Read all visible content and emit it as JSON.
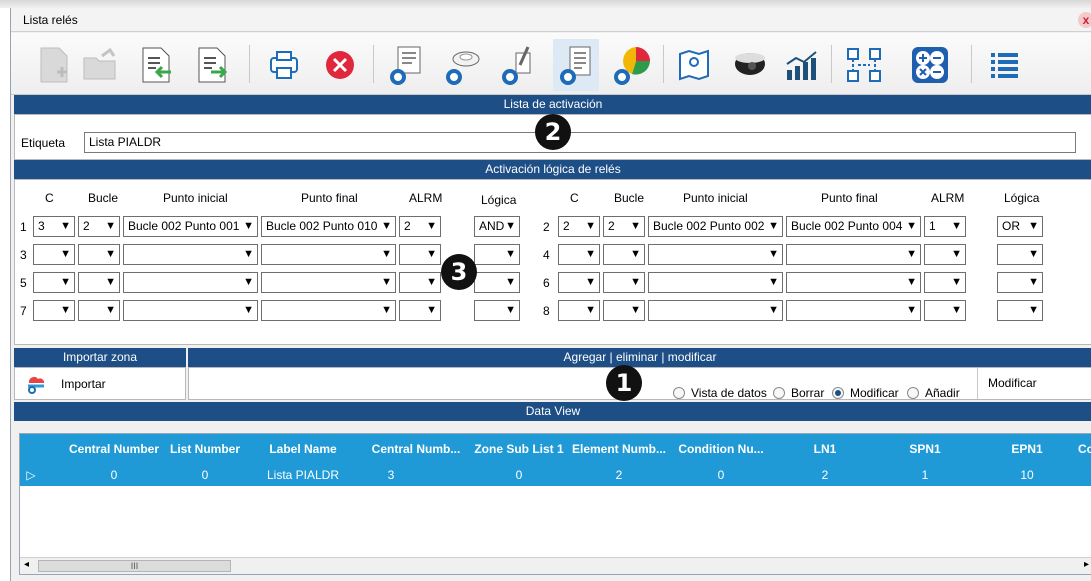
{
  "window": {
    "title": "Lista relés",
    "close_glyph": "x"
  },
  "sections": {
    "activation_list": "Lista de activación",
    "logic": "Activación lógica de relés",
    "import_zone": "Importar zona",
    "edit": "Agregar | eliminar | modificar",
    "data_view": "Data View"
  },
  "etiqueta": {
    "label": "Etiqueta",
    "value": "Lista PIALDR"
  },
  "columns": {
    "c": "C",
    "bucle": "Bucle",
    "punto_inicial": "Punto inicial",
    "punto_final": "Punto final",
    "alrm": "ALRM",
    "logica": "Lógica"
  },
  "rows": [
    {
      "n": "1",
      "c": "3",
      "bucle": "2",
      "inicial": "Bucle 002 Punto 001",
      "final": "Bucle 002 Punto 010",
      "alrm": "2",
      "logica": "AND"
    },
    {
      "n": "2",
      "c": "2",
      "bucle": "2",
      "inicial": "Bucle 002 Punto 002",
      "final": "Bucle 002 Punto 004",
      "alrm": "1",
      "logica": "OR"
    },
    {
      "n": "3",
      "c": "",
      "bucle": "",
      "inicial": "",
      "final": "",
      "alrm": "",
      "logica": ""
    },
    {
      "n": "4",
      "c": "",
      "bucle": "",
      "inicial": "",
      "final": "",
      "alrm": "",
      "logica": ""
    },
    {
      "n": "5",
      "c": "",
      "bucle": "",
      "inicial": "",
      "final": "",
      "alrm": "",
      "logica": ""
    },
    {
      "n": "6",
      "c": "",
      "bucle": "",
      "inicial": "",
      "final": "",
      "alrm": "",
      "logica": ""
    },
    {
      "n": "7",
      "c": "",
      "bucle": "",
      "inicial": "",
      "final": "",
      "alrm": "",
      "logica": ""
    },
    {
      "n": "8",
      "c": "",
      "bucle": "",
      "inicial": "",
      "final": "",
      "alrm": "",
      "logica": ""
    }
  ],
  "import": {
    "label": "Importar"
  },
  "modes": [
    {
      "label": "Vista de datos",
      "selected": false
    },
    {
      "label": "Borrar",
      "selected": false
    },
    {
      "label": "Modificar",
      "selected": true
    },
    {
      "label": "Añadir",
      "selected": false
    }
  ],
  "action_button": "Modificar",
  "badges": {
    "one": "1",
    "two": "2",
    "three": "3"
  },
  "grid": {
    "headers": [
      "Central Number",
      "List Number",
      "Label Name",
      "Central Numb...",
      "Zone Sub List 1",
      "Element Numb...",
      "Condition Nu...",
      "LN1",
      "SPN1",
      "EPN1",
      "Co"
    ],
    "rows": [
      {
        "cells": [
          "0",
          "0",
          "Lista PIALDR",
          "3",
          "0",
          "2",
          "0",
          "2",
          "1",
          "10"
        ]
      }
    ],
    "row_marker": "▷",
    "scroll_label": "III"
  },
  "toolbar_icons": [
    "new-document-icon",
    "open-folder-icon",
    "import-document-icon",
    "export-document-icon",
    "print-icon",
    "delete-icon",
    "config-panel-icon",
    "config-sensor-icon",
    "config-pointer-icon",
    "config-list-icon",
    "config-chart-icon",
    "map-icon",
    "camera-icon",
    "statistics-icon",
    "network-icon",
    "calculator-icon",
    "list-menu-icon"
  ],
  "colors": {
    "band": "#1d4e86",
    "grid_header": "#1f9ad6",
    "delete_red": "#e0283c",
    "accent_blue": "#1e6bb8"
  }
}
